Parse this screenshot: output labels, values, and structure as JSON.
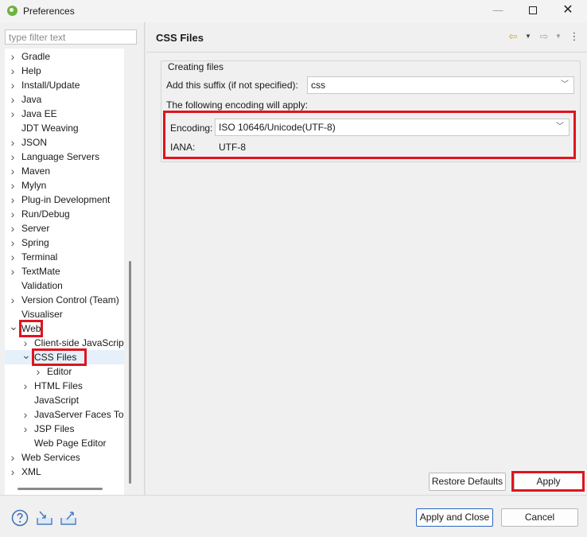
{
  "window": {
    "title": "Preferences",
    "minimize_glyph": "—",
    "close_glyph": "✕",
    "app_icon": "spring-leaf-icon"
  },
  "sidebar": {
    "filter_placeholder": "type filter text",
    "items": [
      {
        "label": "Gradle",
        "expanded": false
      },
      {
        "label": "Help",
        "expanded": false
      },
      {
        "label": "Install/Update",
        "expanded": false
      },
      {
        "label": "Java",
        "expanded": false
      },
      {
        "label": "Java EE",
        "expanded": false
      },
      {
        "label": "JDT Weaving"
      },
      {
        "label": "JSON",
        "expanded": false
      },
      {
        "label": "Language Servers",
        "expanded": false
      },
      {
        "label": "Maven",
        "expanded": false
      },
      {
        "label": "Mylyn",
        "expanded": false
      },
      {
        "label": "Plug-in Development",
        "expanded": false
      },
      {
        "label": "Run/Debug",
        "expanded": false
      },
      {
        "label": "Server",
        "expanded": false
      },
      {
        "label": "Spring",
        "expanded": false
      },
      {
        "label": "Terminal",
        "expanded": false
      },
      {
        "label": "TextMate",
        "expanded": false
      },
      {
        "label": "Validation"
      },
      {
        "label": "Version Control (Team)",
        "expanded": false
      },
      {
        "label": "Visualiser"
      },
      {
        "label": "Web",
        "expanded": true,
        "highlighted": true
      },
      {
        "label": "Client-side JavaScript",
        "expanded": false
      },
      {
        "label": "CSS Files",
        "expanded": true,
        "selected": true,
        "highlighted": true
      },
      {
        "label": "Editor",
        "expanded": false
      },
      {
        "label": "HTML Files",
        "expanded": false
      },
      {
        "label": "JavaScript"
      },
      {
        "label": "JavaServer Faces Tools",
        "expanded": false
      },
      {
        "label": "JSP Files",
        "expanded": false
      },
      {
        "label": "Web Page Editor"
      },
      {
        "label": "Web Services",
        "expanded": false
      },
      {
        "label": "XML",
        "expanded": false
      }
    ]
  },
  "page": {
    "title": "CSS Files",
    "back_icon": "back-arrow-icon",
    "forward_icon": "forward-arrow-icon",
    "menu_icon": "view-menu-icon",
    "group_title": "Creating files",
    "suffix_label": "Add this suffix (if not specified):",
    "suffix_value": "css",
    "encoding_note": "The following encoding will apply:",
    "encoding_label": "Encoding:",
    "encoding_value": "ISO 10646/Unicode(UTF-8)",
    "iana_label": "IANA:",
    "iana_value": "UTF-8",
    "restore_defaults": "Restore Defaults",
    "apply": "Apply"
  },
  "footer": {
    "help_icon": "help-icon",
    "import_icon": "import-icon",
    "export_icon": "export-icon",
    "apply_and_close": "Apply and Close",
    "cancel": "Cancel"
  },
  "colors": {
    "highlight_box": "#e0141e",
    "default_button_border": "#2a66c3"
  }
}
